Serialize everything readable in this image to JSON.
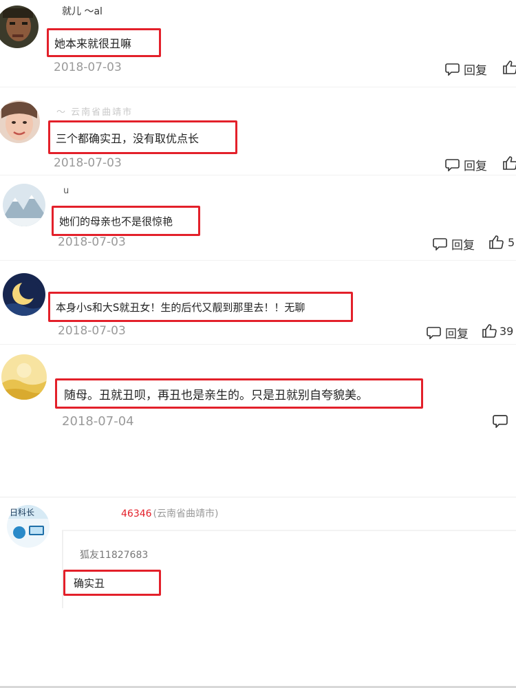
{
  "comments": [
    {
      "username": "就儿   ～al",
      "body": "她本来就很丑嘛",
      "date": "2018-07-03",
      "reply_label": "回复",
      "like_count": ""
    },
    {
      "username": "～  云南省曲靖市",
      "body": "三个都确实丑，没有取优点长",
      "date": "2018-07-03",
      "reply_label": "回复",
      "like_count": ""
    },
    {
      "username": "u",
      "body": "她们的母亲也不是很惊艳",
      "date": "2018-07-03",
      "reply_label": "回复",
      "like_count": "5"
    },
    {
      "username": "",
      "body": "本身小s和大S就丑女！生的后代又靓到那里去！！无聊",
      "date": "2018-07-03",
      "reply_label": "回复",
      "like_count": "39"
    },
    {
      "username": "",
      "body": "随母。丑就丑呗，再丑也是亲生的。只是丑就别自夸貌美。",
      "date": "2018-07-04",
      "reply_label": "",
      "like_count": ""
    }
  ],
  "reply_thread": {
    "avatar_text": "日科长",
    "user_id_partial": "46346",
    "user_location": "(云南省曲靖市)",
    "quoted_user": "狐友11827683",
    "quoted_body": "确实丑"
  },
  "colors": {
    "highlight_box": "#e3202a",
    "user_id_red": "#e3202a",
    "meta_gray": "#9a9a9a"
  }
}
